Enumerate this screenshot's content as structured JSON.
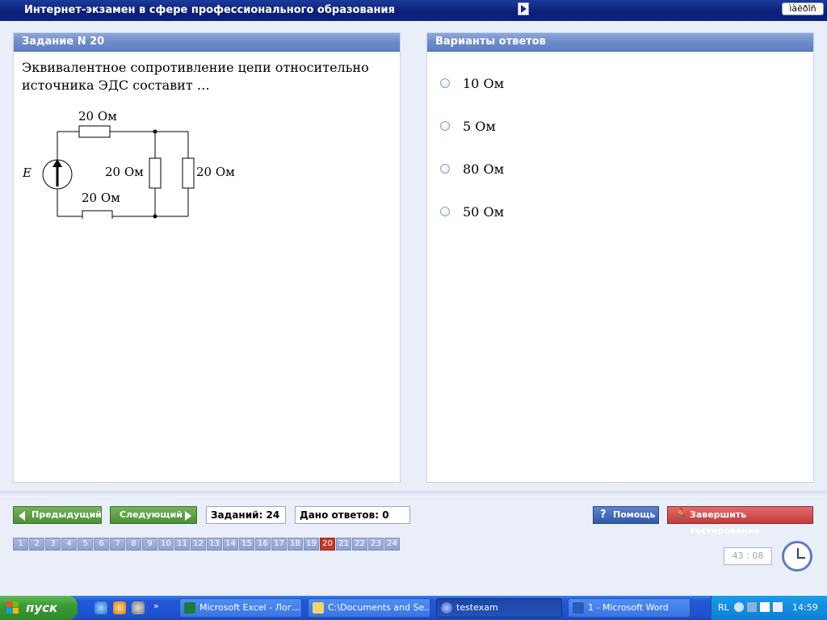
{
  "window": {
    "title": "Интернет-экзамен в сфере профессионального образования",
    "lang_indicator": "ìàëðîñ"
  },
  "question": {
    "header": "Задание N 20",
    "text": "Эквивалентное сопротивление цепи относительно источника ЭДС составит …",
    "circuit": {
      "source_label": "E",
      "r_top": "20 Ом",
      "r_bottom": "20 Ом",
      "r_middle": "20 Ом",
      "r_right": "20 Ом"
    }
  },
  "answers": {
    "header": "Варианты ответов",
    "options": [
      {
        "label": "10 Ом"
      },
      {
        "label": "5 Ом"
      },
      {
        "label": "80 Ом"
      },
      {
        "label": "50 Ом"
      }
    ]
  },
  "nav": {
    "prev_label": "Предыдущий",
    "next_label": "Следующий",
    "tasks_count": "Заданий: 24",
    "answers_given": "Дано ответов: 0",
    "help_label": "Помощь",
    "finish_label": "Завершить тестирование"
  },
  "question_numbers": [
    "1",
    "2",
    "3",
    "4",
    "5",
    "6",
    "7",
    "8",
    "9",
    "10",
    "11",
    "12",
    "13",
    "14",
    "15",
    "16",
    "17",
    "18",
    "19",
    "20",
    "21",
    "22",
    "23",
    "24"
  ],
  "current_question": "20",
  "timer": "43 : 08",
  "taskbar": {
    "start_label": "пуск",
    "items": [
      {
        "label": "Microsoft Excel - Лог...",
        "icon": "excel-icon"
      },
      {
        "label": "C:\\Documents and Se...",
        "icon": "folder-icon"
      },
      {
        "label": "testexam",
        "icon": "testexam-icon"
      },
      {
        "label": "1 - Microsoft Word",
        "icon": "word-icon"
      }
    ],
    "tray_lang": "RL",
    "clock": "14:59"
  },
  "colors": {
    "titlebar": "#0a1f77",
    "panel_header": "#6e8ccb",
    "nav_green": "#4b8f37",
    "help_blue": "#3158a8",
    "finish_red": "#c23c3c",
    "current_qnum": "#c43a2a"
  }
}
